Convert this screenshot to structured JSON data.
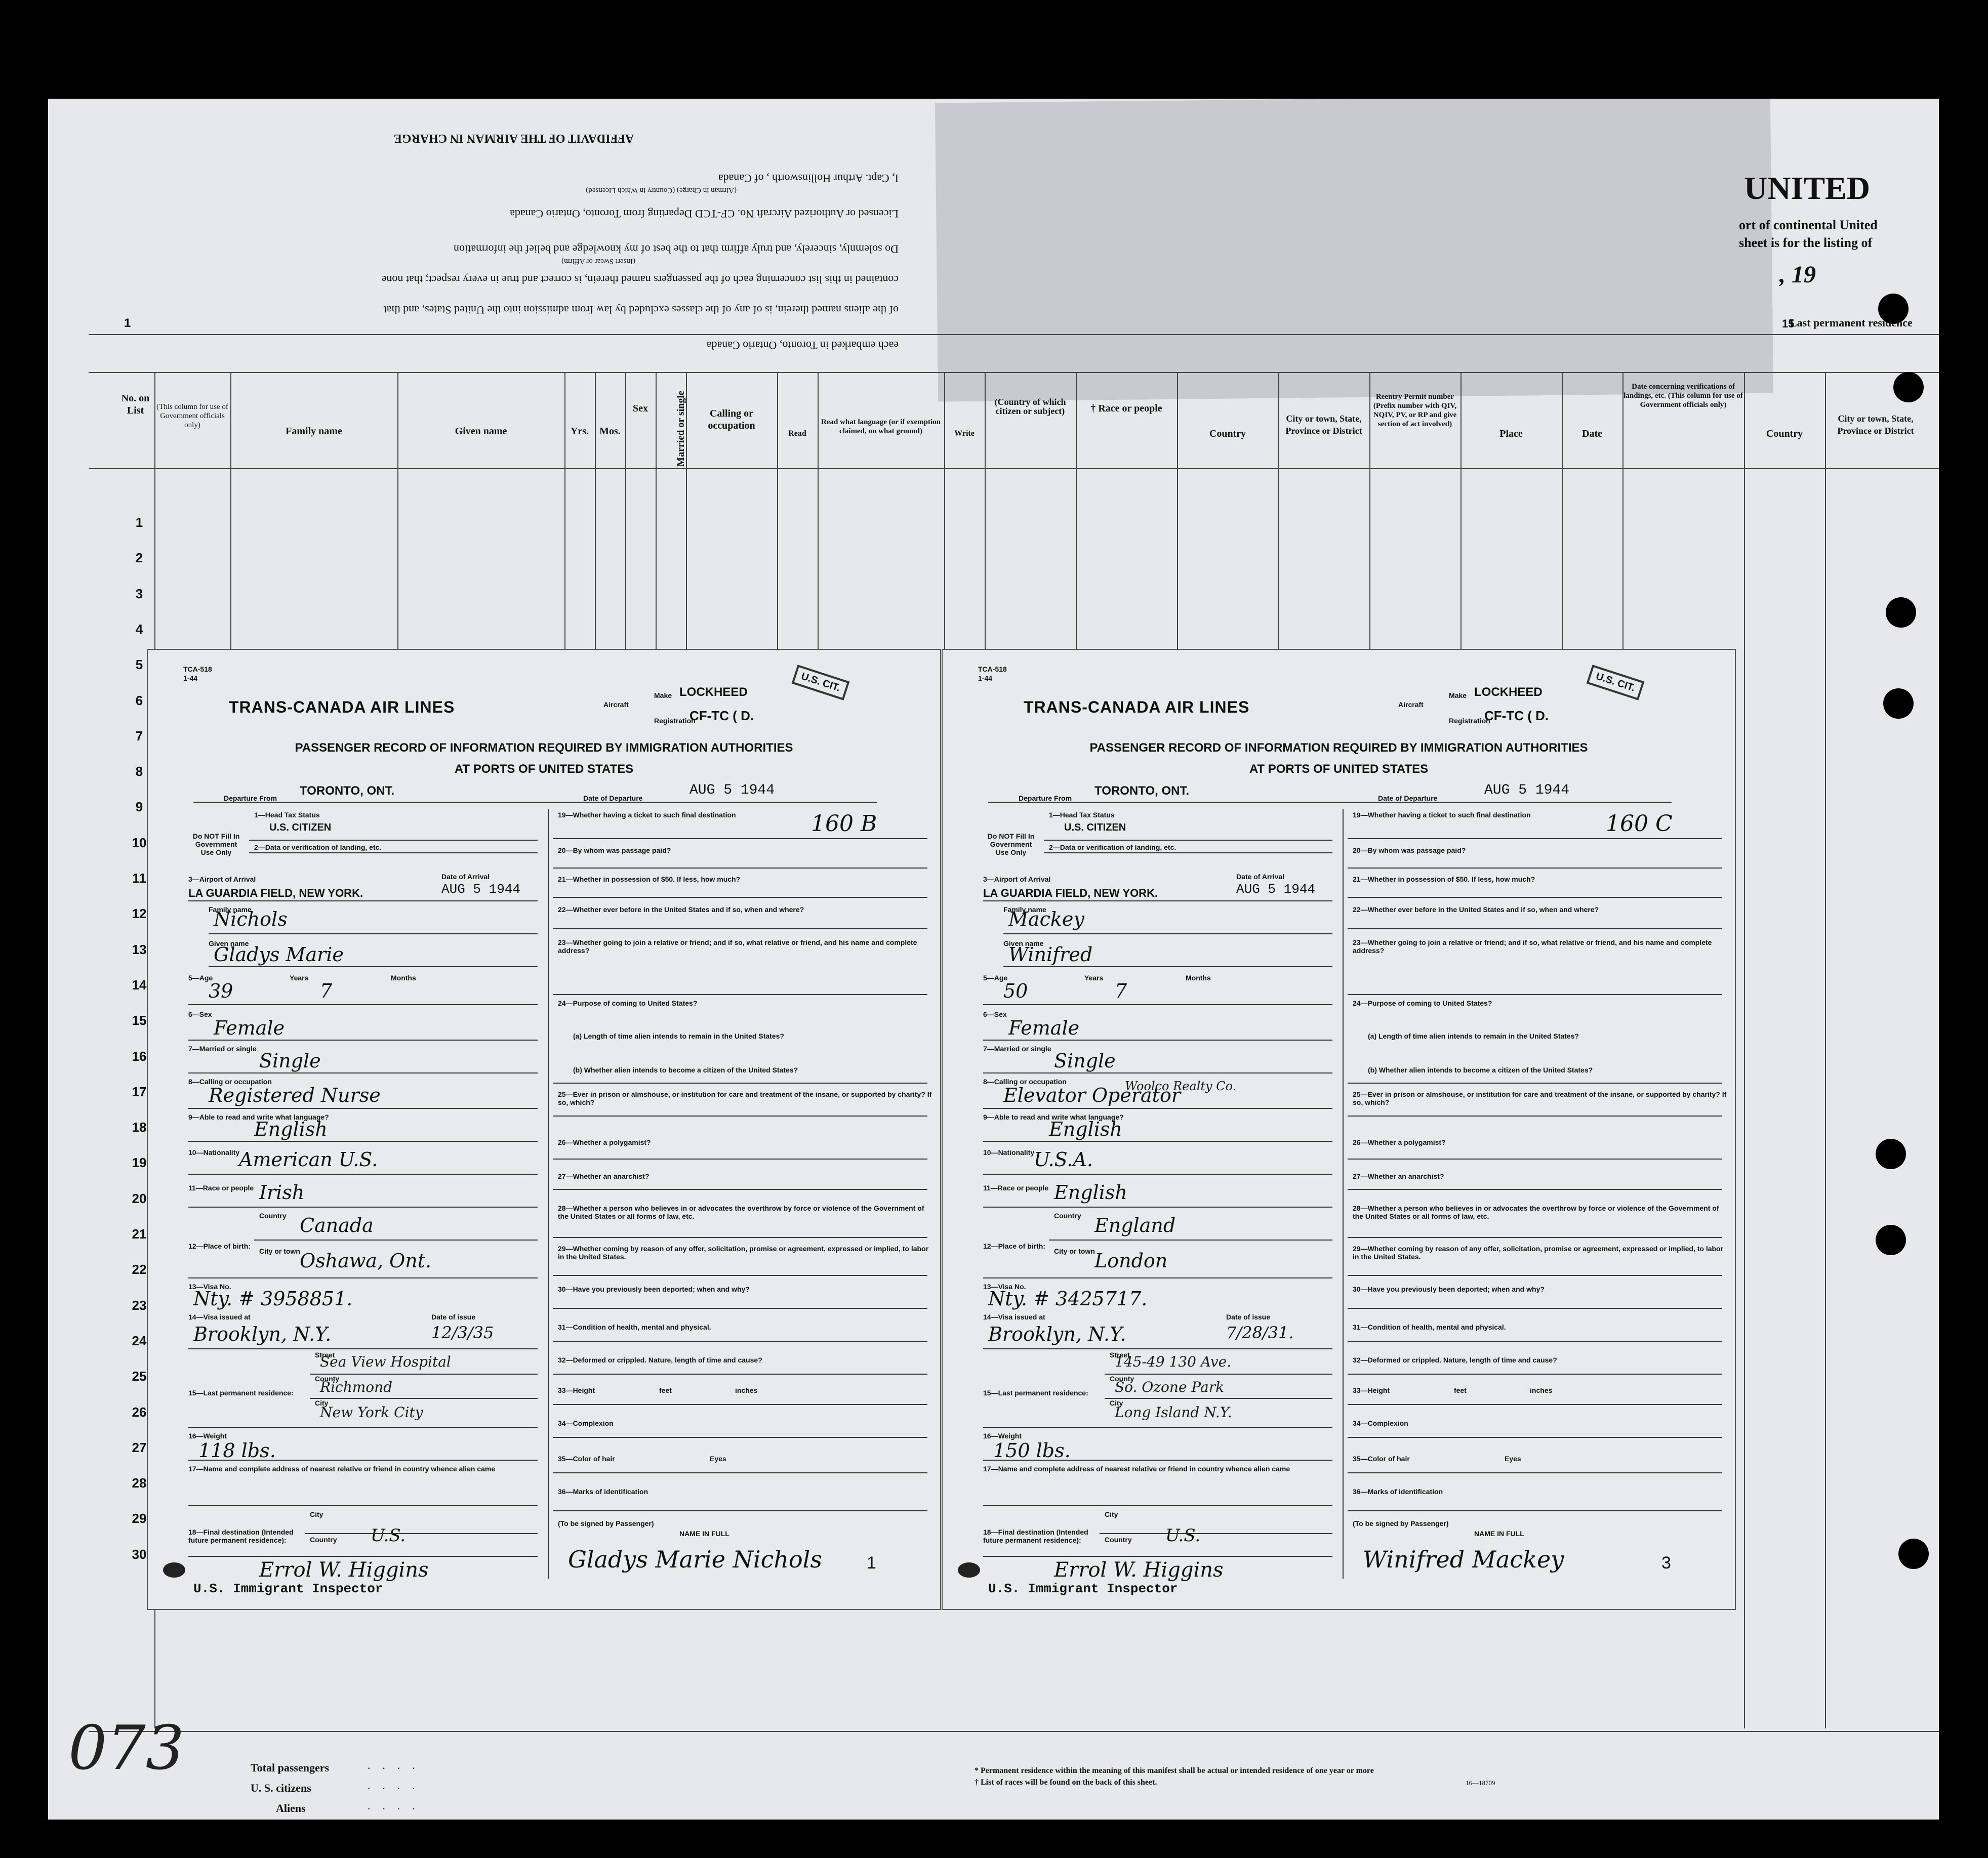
{
  "sheet": {
    "title_fragment": "UNITED",
    "subtitle_lines": [
      "ort of continental United",
      "sheet is for the listing of"
    ],
    "year_fragment": ", 19",
    "col_num_1": "1",
    "col_num_15": "15",
    "row_numbers": [
      "1",
      "2",
      "3",
      "4",
      "5",
      "6",
      "7",
      "8",
      "9",
      "10",
      "11",
      "12",
      "13",
      "14",
      "15",
      "16",
      "17",
      "18",
      "19",
      "20",
      "21",
      "22",
      "23",
      "24",
      "25",
      "26",
      "27",
      "28",
      "29",
      "30"
    ],
    "handwritten_page": "073",
    "affidavit": {
      "heading": "AFFIDAVIT OF THE AIRMAN IN CHARGE",
      "line1": "I, Capt. Arthur Hollinsworth , of Canada",
      "line1_sub": "(Airman in Charge)   (Country in Which Licensed)",
      "line2": "Licensed or Authorized Aircraft No. CF-TCD Departing from Toronto, Ontario Canada",
      "line3": "Do solemnly, sincerely, and truly affirm that to the best of my knowledge and belief the information",
      "line3_sub": "(Insert Swear or Affirm)",
      "line4": "contained in this list concerning each of the passengers named therein, is correct and true in every respect; that none",
      "line5": "of the aliens named therein, is of any of the classes excluded by law from admission into the United States, and that",
      "line6": "each embarked in Toronto, Ontario Canada"
    },
    "columns": [
      "No. on List",
      "(This column for use of Government officials only)",
      "Family name",
      "Given name",
      "Yrs.",
      "Mos.",
      "Sex",
      "Married or single",
      "Calling or occupation",
      "Read",
      "Read what language (or if exemption claimed, on what ground)",
      "Write",
      "(Country of which citizen or subject)",
      "† Race or people",
      "Country",
      "City or town, State, Province or District",
      "Reentry Permit number (Prefix number with QIV, NQIV, PV, or RP and give section of act involved)",
      "Place",
      "Date",
      "Date concerning verifications of landings, etc. (This column for use of Government officials only)",
      "Country",
      "City or town, State, Province or District"
    ],
    "last_residence_header": "Last permanent residence",
    "footer": {
      "total_passengers": "Total passengers",
      "us_citizens": "U. S. citizens",
      "aliens": "Aliens",
      "note1": "* Permanent residence within the meaning of this manifest shall be actual or intended residence of one year or more",
      "note2": "† List of races will be found on the back of this sheet.",
      "form_no": "16—18709"
    }
  },
  "form_labels": {
    "form_id": "TCA-518",
    "form_date": "1-44",
    "airline": "TRANS-CANADA AIR LINES",
    "aircraft": "Aircraft",
    "make": "Make",
    "registration": "Registration",
    "title1": "PASSENGER RECORD OF INFORMATION REQUIRED BY IMMIGRATION AUTHORITIES",
    "title2": "AT PORTS OF UNITED STATES",
    "departure_from": "Departure From",
    "date_of_departure": "Date of Departure",
    "do_not_fill": "Do NOT Fill In Government Use Only",
    "f1": "1—Head Tax Status",
    "f2": "2—Data or verification of landing, etc.",
    "f3": "3—Airport of Arrival",
    "date_of_arrival": "Date of Arrival",
    "family_name": "Family name",
    "given_name": "Given name",
    "f5": "5—Age",
    "years": "Years",
    "months": "Months",
    "f6": "6—Sex",
    "f7": "7—Married or single",
    "f8": "8—Calling or occupation",
    "f9": "9—Able to read and write what language?",
    "f10": "10—Nationality",
    "f11": "11—Race or people",
    "f12": "12—Place of birth:",
    "country": "Country",
    "city_or_town": "City or town",
    "f13": "13—Visa No.",
    "f14": "14—Visa issued at",
    "date_of_issue": "Date of issue",
    "f15": "15—Last permanent residence:",
    "street": "Street",
    "county": "County",
    "city": "City",
    "f16": "16—Weight",
    "f17": "17—Name and complete address of nearest relative or friend in country whence alien came",
    "f18": "18—Final destination (Intended future permanent residence):",
    "city_label": "City",
    "country_label": "Country",
    "q19": "19—Whether having a ticket to such final destination",
    "q20": "20—By whom was passage paid?",
    "q21": "21—Whether in possession of $50. If less, how much?",
    "q22": "22—Whether ever before in the United States and if so, when and where?",
    "q23": "23—Whether going to join a relative or friend; and if so, what relative or friend, and his name and complete address?",
    "q24": "24—Purpose of coming to United States?",
    "q24a": "(a) Length of time alien intends to remain in the United States?",
    "q24b": "(b) Whether alien intends to become a citizen of the United States?",
    "q25": "25—Ever in prison or almshouse, or institution for care and treatment of the insane, or supported by charity? If so, which?",
    "q26": "26—Whether a polygamist?",
    "q27": "27—Whether an anarchist?",
    "q28": "28—Whether a person who believes in or advocates the overthrow by force or violence of the Government of the United States or all forms of law, etc.",
    "q29": "29—Whether coming by reason of any offer, solicitation, promise or agreement, expressed or implied, to labor in the United States.",
    "q30": "30—Have you previously been deported; when and why?",
    "q31": "31—Condition of health, mental and physical.",
    "q32": "32—Deformed or crippled. Nature, length of time and cause?",
    "q33": "33—Height",
    "feet": "feet",
    "inches": "inches",
    "q34": "34—Complexion",
    "q35": "35—Color of hair",
    "eyes": "Eyes",
    "q36": "36—Marks of identification",
    "to_be_signed": "(To be signed by Passenger)",
    "name_in_full": "NAME IN FULL",
    "inspector": "U.S. Immigrant Inspector"
  },
  "cards": [
    {
      "make": "LOCKHEED",
      "registration": "CF-TC ( D.",
      "stamp": "U.S. CIT.",
      "departure_from": "TORONTO, ONT.",
      "departure_date": "AUG 5 1944",
      "ticket": "160 B",
      "head_tax": "U.S. CITIZEN",
      "airport": "LA GUARDIA FIELD, NEW YORK.",
      "arrival_date": "AUG 5 1944",
      "family_name": "Nichols",
      "given_name": "Gladys Marie",
      "age_years": "39",
      "age_months": "7",
      "sex": "Female",
      "married": "Single",
      "occupation": "Registered Nurse",
      "occupation_extra": "",
      "language": "English",
      "nationality": "American U.S.",
      "race": "Irish",
      "birth_country": "Canada",
      "birth_city": "Oshawa, Ont.",
      "visa_no": "Nty. # 3958851.",
      "visa_issued": "Brooklyn, N.Y.",
      "visa_date": "12/3/35",
      "res_street": "Sea View Hospital",
      "res_county": "Richmond",
      "res_city": "New York City",
      "weight": "118 lbs.",
      "final_country": "U.S.",
      "signature": "Gladys Marie Nichols",
      "inspector_sig": "Errol W. Higgins",
      "page_mark": "1"
    },
    {
      "make": "LOCKHEED",
      "registration": "CF-TC ( D.",
      "stamp": "U.S. CIT.",
      "departure_from": "TORONTO, ONT.",
      "departure_date": "AUG 5 1944",
      "ticket": "160 C",
      "head_tax": "U.S. CITIZEN",
      "airport": "LA GUARDIA FIELD, NEW YORK.",
      "arrival_date": "AUG 5 1944",
      "family_name": "Mackey",
      "given_name": "Winifred",
      "age_years": "50",
      "age_months": "7",
      "sex": "Female",
      "married": "Single",
      "occupation": "Elevator Operator",
      "occupation_extra": "Woolco Realty Co.",
      "language": "English",
      "nationality": "U.S.A.",
      "race": "English",
      "birth_country": "England",
      "birth_city": "London",
      "visa_no": "Nty. # 3425717.",
      "visa_issued": "Brooklyn, N.Y.",
      "visa_date": "7/28/31.",
      "res_street": "145-49 130 Ave.",
      "res_county": "So. Ozone Park",
      "res_city": "Long Island N.Y.",
      "weight": "150 lbs.",
      "final_country": "U.S.",
      "signature": "Winifred Mackey",
      "inspector_sig": "Errol W. Higgins",
      "page_mark": "3"
    }
  ]
}
